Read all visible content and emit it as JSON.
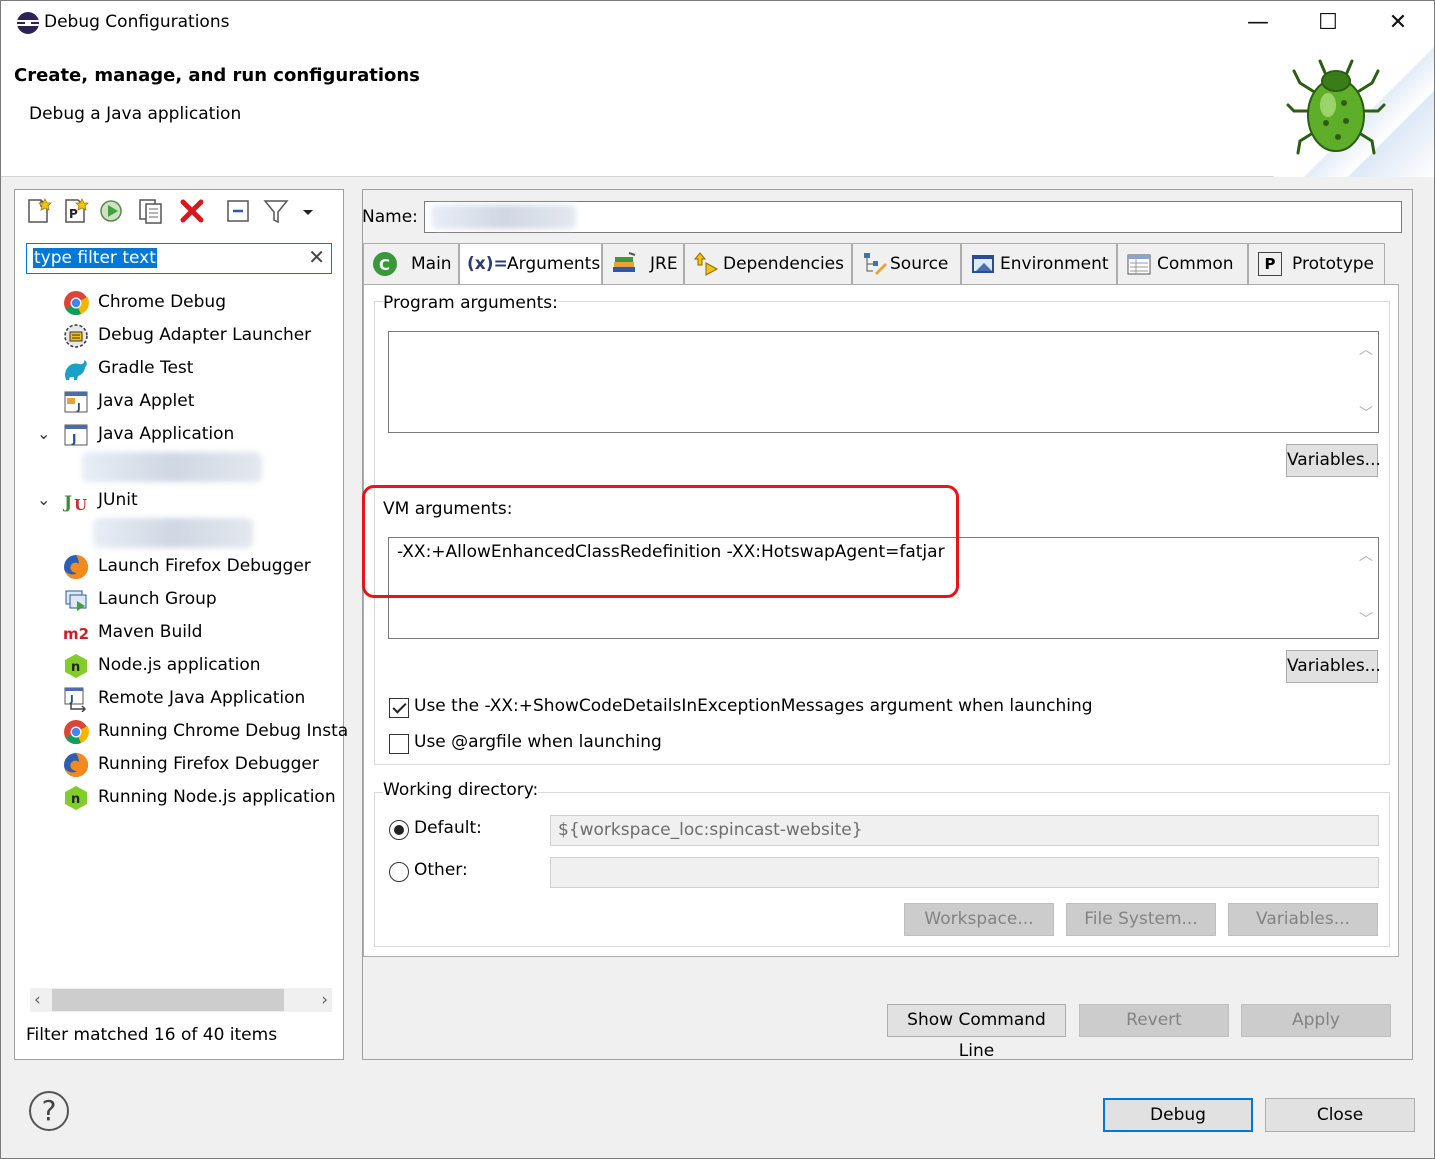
{
  "window": {
    "title": "Debug Configurations",
    "minimize": "—",
    "maximize": "☐",
    "close": "✕"
  },
  "header": {
    "title": "Create, manage, and run configurations",
    "subtitle": "Debug a Java application"
  },
  "left": {
    "filter_text": "type filter text",
    "items": [
      {
        "label": "Chrome Debug",
        "icon": "chrome-icon"
      },
      {
        "label": "Debug Adapter Launcher",
        "icon": "debug-adapter-icon"
      },
      {
        "label": "Gradle Test",
        "icon": "gradle-icon"
      },
      {
        "label": "Java Applet",
        "icon": "java-applet-icon"
      },
      {
        "label": "Java Application",
        "icon": "java-application-icon"
      },
      {
        "label": "JUnit",
        "icon": "junit-icon"
      },
      {
        "label": "Launch Firefox Debugger",
        "icon": "firefox-icon"
      },
      {
        "label": "Launch Group",
        "icon": "launch-group-icon"
      },
      {
        "label": "Maven Build",
        "icon": "maven-icon"
      },
      {
        "label": "Node.js application",
        "icon": "nodejs-icon"
      },
      {
        "label": "Remote Java Application",
        "icon": "remote-java-icon"
      },
      {
        "label": "Running Chrome Debug Insta",
        "icon": "chrome-icon"
      },
      {
        "label": "Running Firefox Debugger",
        "icon": "firefox-icon"
      },
      {
        "label": "Running Node.js application",
        "icon": "nodejs-icon"
      }
    ],
    "filter_status": "Filter matched 16 of 40 items"
  },
  "right": {
    "name_label": "Name:",
    "tabs": [
      {
        "label": "Main",
        "icon": "main-tab-icon"
      },
      {
        "label": "Arguments",
        "icon": "arguments-tab-icon",
        "prefix": "(x)="
      },
      {
        "label": "JRE",
        "icon": "jre-tab-icon"
      },
      {
        "label": "Dependencies",
        "icon": "dependencies-tab-icon"
      },
      {
        "label": "Source",
        "icon": "source-tab-icon"
      },
      {
        "label": "Environment",
        "icon": "environment-tab-icon"
      },
      {
        "label": "Common",
        "icon": "common-tab-icon"
      },
      {
        "label": "Prototype",
        "icon": "prototype-tab-icon",
        "prefix": "P"
      }
    ],
    "program_args_label": "Program arguments:",
    "program_args_value": "",
    "variables_label": "Variables...",
    "vm_args_label": "VM arguments:",
    "vm_args_value": "-XX:+AllowEnhancedClassRedefinition -XX:HotswapAgent=fatjar",
    "show_code_details_label": "Use the -XX:+ShowCodeDetailsInExceptionMessages argument when launching",
    "argfile_label": "Use @argfile when launching",
    "working_dir_label": "Working directory:",
    "default_label": "Default:",
    "default_value": "${workspace_loc:spincast-website}",
    "other_label": "Other:",
    "workspace_button": "Workspace...",
    "file_system_button": "File System...",
    "variables_button_wd": "Variables...",
    "show_cmd_button": "Show Command Line",
    "revert_button": "Revert",
    "apply_button": "Apply"
  },
  "footer": {
    "help": "?",
    "debug_button": "Debug",
    "close_button": "Close"
  }
}
